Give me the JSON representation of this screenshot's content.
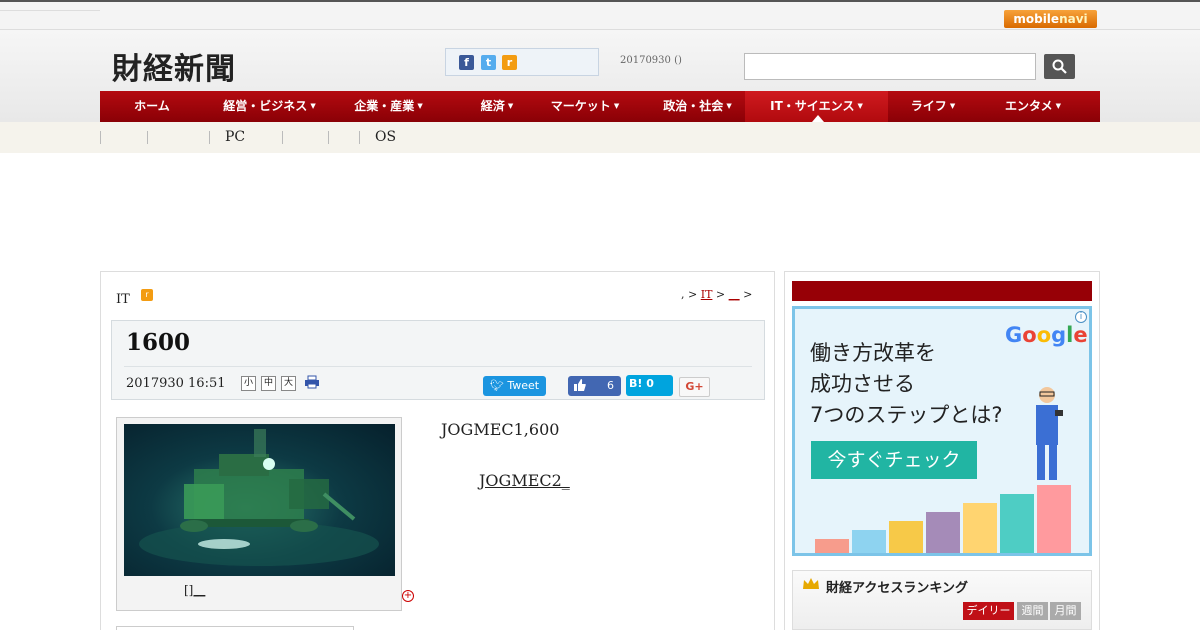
{
  "topbar": {
    "mobile_prefix": "mobile",
    "mobile_suffix": "navi"
  },
  "header": {
    "logo": "財経新聞",
    "date": "20170930 ()",
    "search": {
      "placeholder": "",
      "value": ""
    },
    "social": {
      "facebook": "f",
      "twitter": "t",
      "rss": "r"
    }
  },
  "nav": {
    "items": [
      {
        "label": "ホーム"
      },
      {
        "label": "経営・ビジネス",
        "arrow": "▼"
      },
      {
        "label": "企業・産業",
        "arrow": "▼"
      },
      {
        "label": "経済",
        "arrow": "▼"
      },
      {
        "label": "マーケット",
        "arrow": "▼"
      },
      {
        "label": "政治・社会",
        "arrow": "▼"
      },
      {
        "label": "IT・サイエンス",
        "arrow": "▼",
        "active": true
      },
      {
        "label": "ライフ",
        "arrow": "▼"
      },
      {
        "label": "エンタメ",
        "arrow": "▼"
      }
    ]
  },
  "subnav": {
    "items": [
      "PC",
      "OS"
    ]
  },
  "article": {
    "category": "IT",
    "breadcrumb": {
      "sep1": ", >",
      "link1": "IT",
      "sep2": ">",
      "link2": "__",
      "sep3": ">"
    },
    "title": "1600",
    "date": "2017930 16:51",
    "font_sizes": [
      "小",
      "中",
      "大"
    ],
    "tweet_label": "Tweet",
    "like_count": "6",
    "hatena_label": "B! 0",
    "gplus_label": "G+",
    "photo_caption": "[]__",
    "zoom_label": "+",
    "body_1": "JOGMEC1,600",
    "body_2": "JOGMEC2_"
  },
  "sidebar": {
    "ad": {
      "info": "i",
      "google": "Google",
      "lines": [
        "働き方改革を",
        "成功させる",
        "7つのステップとは?"
      ],
      "cta": "今すぐチェック",
      "bars": [
        {
          "value": 0.16,
          "color": "#f79c8c"
        },
        {
          "value": 0.26,
          "color": "#8ed3f0"
        },
        {
          "value": 0.36,
          "color": "#f7c948"
        },
        {
          "value": 0.46,
          "color": "#a58bb8"
        },
        {
          "value": 0.56,
          "color": "#ffd470"
        },
        {
          "value": 0.66,
          "color": "#4ecdc4"
        },
        {
          "value": 0.76,
          "color": "#ff9a9e"
        }
      ]
    },
    "ranking": {
      "title": "財経アクセスランキング",
      "tabs": [
        "デイリー",
        "週間",
        "月間"
      ]
    }
  },
  "colors": {
    "nav_red": "#b40a10",
    "accent_red": "#970006",
    "tweet_blue": "#1b95e0",
    "fb_blue": "#4267b2",
    "hatena_blue": "#00a4de"
  }
}
